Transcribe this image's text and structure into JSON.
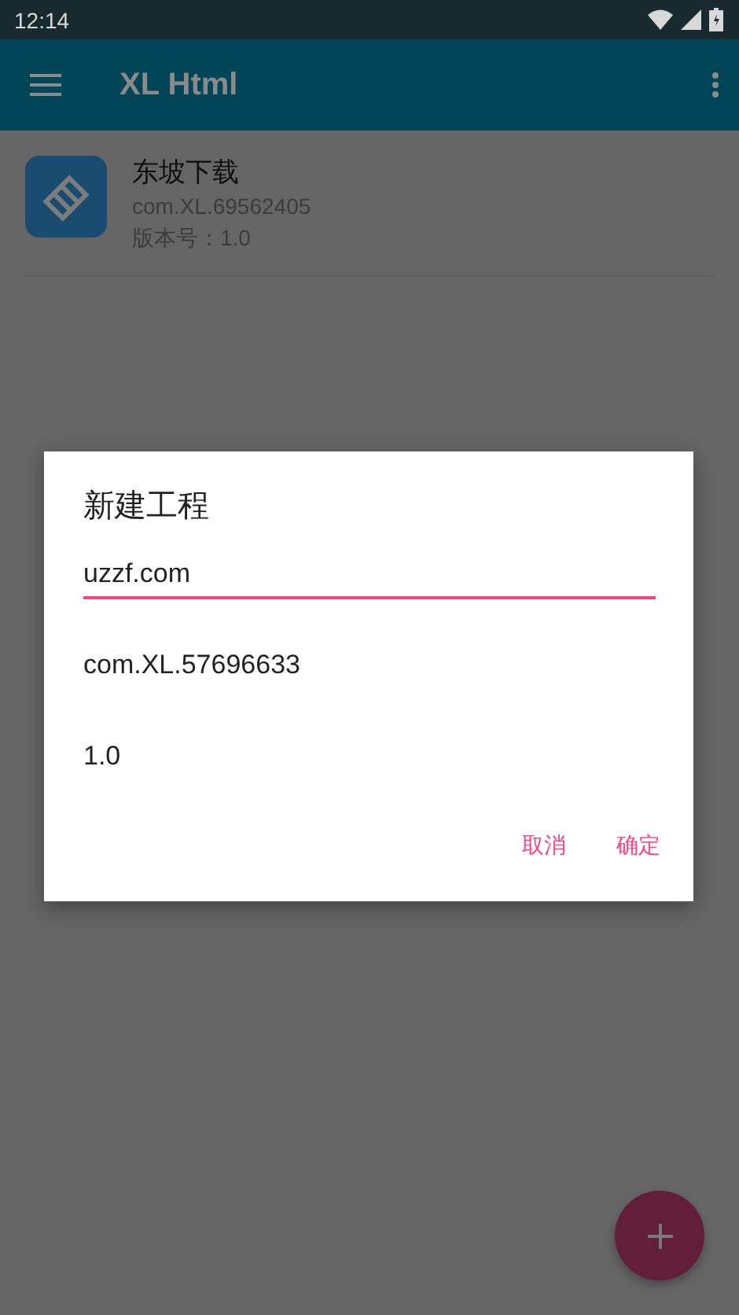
{
  "status_bar": {
    "time": "12:14"
  },
  "toolbar": {
    "title": "XL Html"
  },
  "projects": [
    {
      "name": "东坡下载",
      "package": "com.XL.69562405",
      "version": "版本号：1.0"
    }
  ],
  "dialog": {
    "title": "新建工程",
    "fields": [
      {
        "value": "uzzf.com",
        "focused": true
      },
      {
        "value": "com.XL.57696633",
        "focused": false
      },
      {
        "value": "1.0",
        "focused": false
      }
    ],
    "buttons": [
      "取消",
      "确定"
    ]
  }
}
